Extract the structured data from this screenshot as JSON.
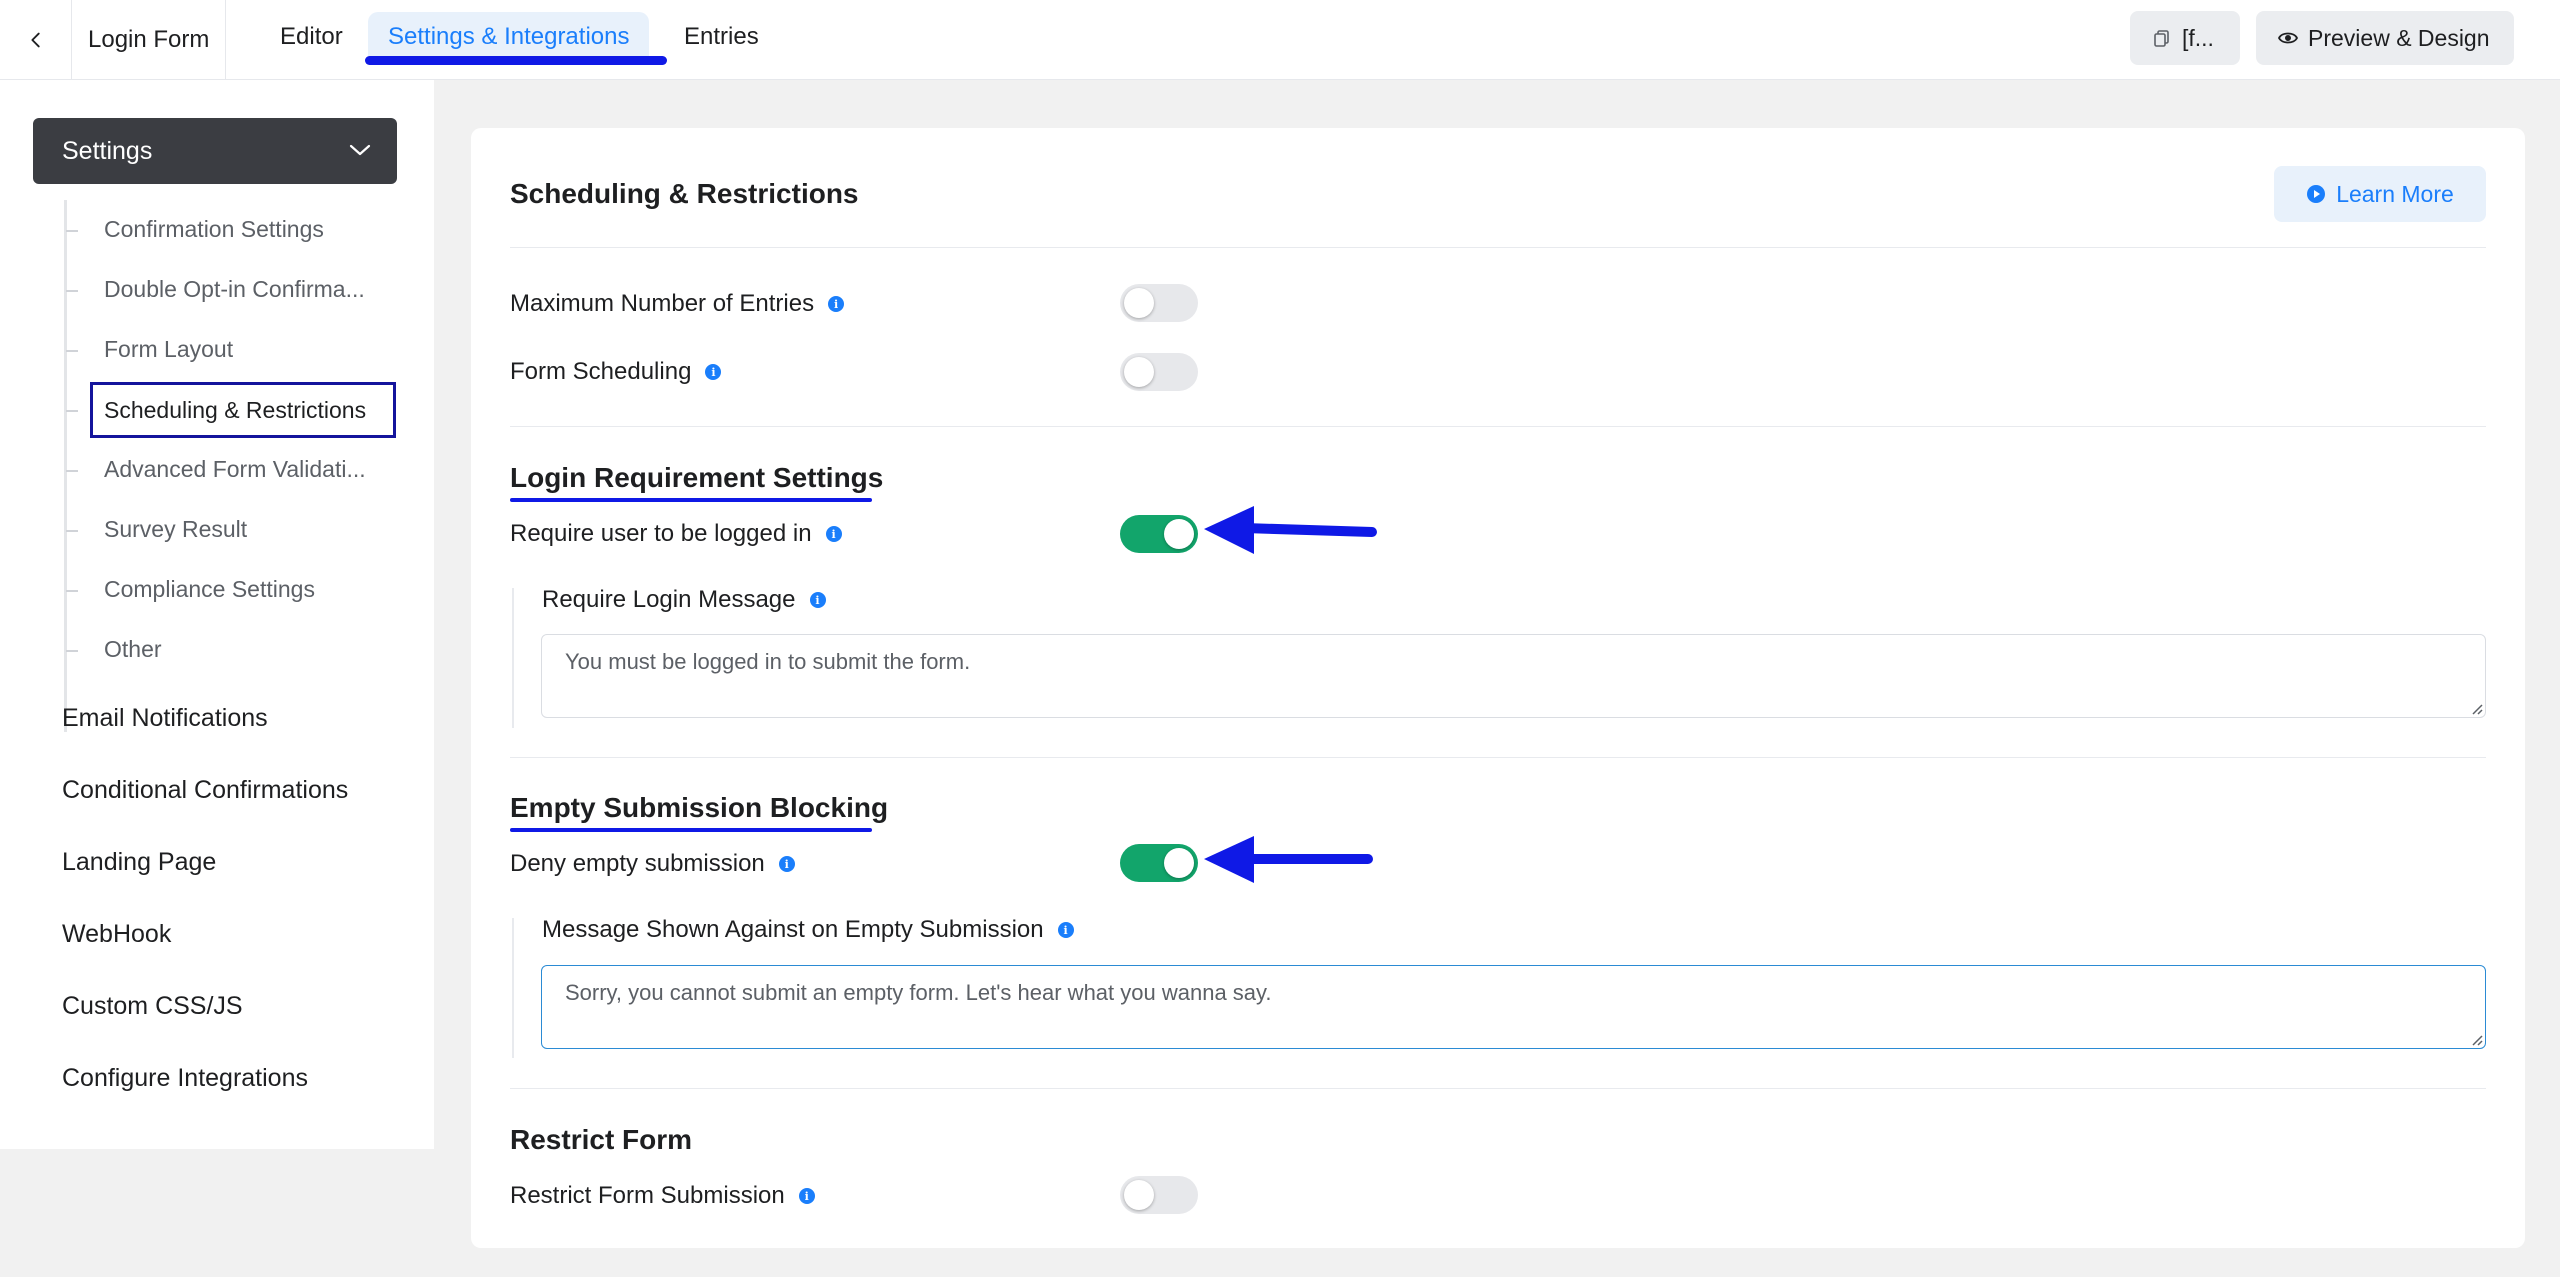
{
  "topbar": {
    "form_title": "Login Form",
    "tabs": [
      {
        "label": "Editor"
      },
      {
        "label": "Settings & Integrations"
      },
      {
        "label": "Entries"
      }
    ],
    "shortcode_label": "[f...",
    "preview_label": "Preview & Design"
  },
  "sidebar": {
    "header": "Settings",
    "sub_items": [
      {
        "label": "Confirmation Settings"
      },
      {
        "label": "Double Opt-in Confirma..."
      },
      {
        "label": "Form Layout"
      },
      {
        "label": "Scheduling & Restrictions"
      },
      {
        "label": "Advanced Form Validati..."
      },
      {
        "label": "Survey Result"
      },
      {
        "label": "Compliance Settings"
      },
      {
        "label": "Other"
      }
    ],
    "main_items": [
      {
        "label": "Email Notifications"
      },
      {
        "label": "Conditional Confirmations"
      },
      {
        "label": "Landing Page"
      },
      {
        "label": "WebHook"
      },
      {
        "label": "Custom CSS/JS"
      },
      {
        "label": "Configure Integrations"
      }
    ]
  },
  "content": {
    "title": "Scheduling & Restrictions",
    "learn_more": "Learn More",
    "rows": {
      "max_entries": {
        "label": "Maximum Number of Entries",
        "enabled": false
      },
      "scheduling": {
        "label": "Form Scheduling",
        "enabled": false
      }
    },
    "login": {
      "section_title": "Login Requirement Settings",
      "toggle_label": "Require user to be logged in",
      "enabled": true,
      "message_label": "Require Login Message",
      "message_value": "You must be logged in to submit the form."
    },
    "empty": {
      "section_title": "Empty Submission Blocking",
      "toggle_label": "Deny empty submission",
      "enabled": true,
      "message_label": "Message Shown Against on Empty Submission",
      "message_value": "Sorry, you cannot submit an empty form. Let's hear what you wanna say."
    },
    "restrict": {
      "section_title": "Restrict Form",
      "toggle_label": "Restrict Form Submission",
      "enabled": false
    }
  },
  "colors": {
    "accent": "#1a7efb",
    "toggle_on": "#12a56b",
    "annotation": "#0f19e6"
  }
}
